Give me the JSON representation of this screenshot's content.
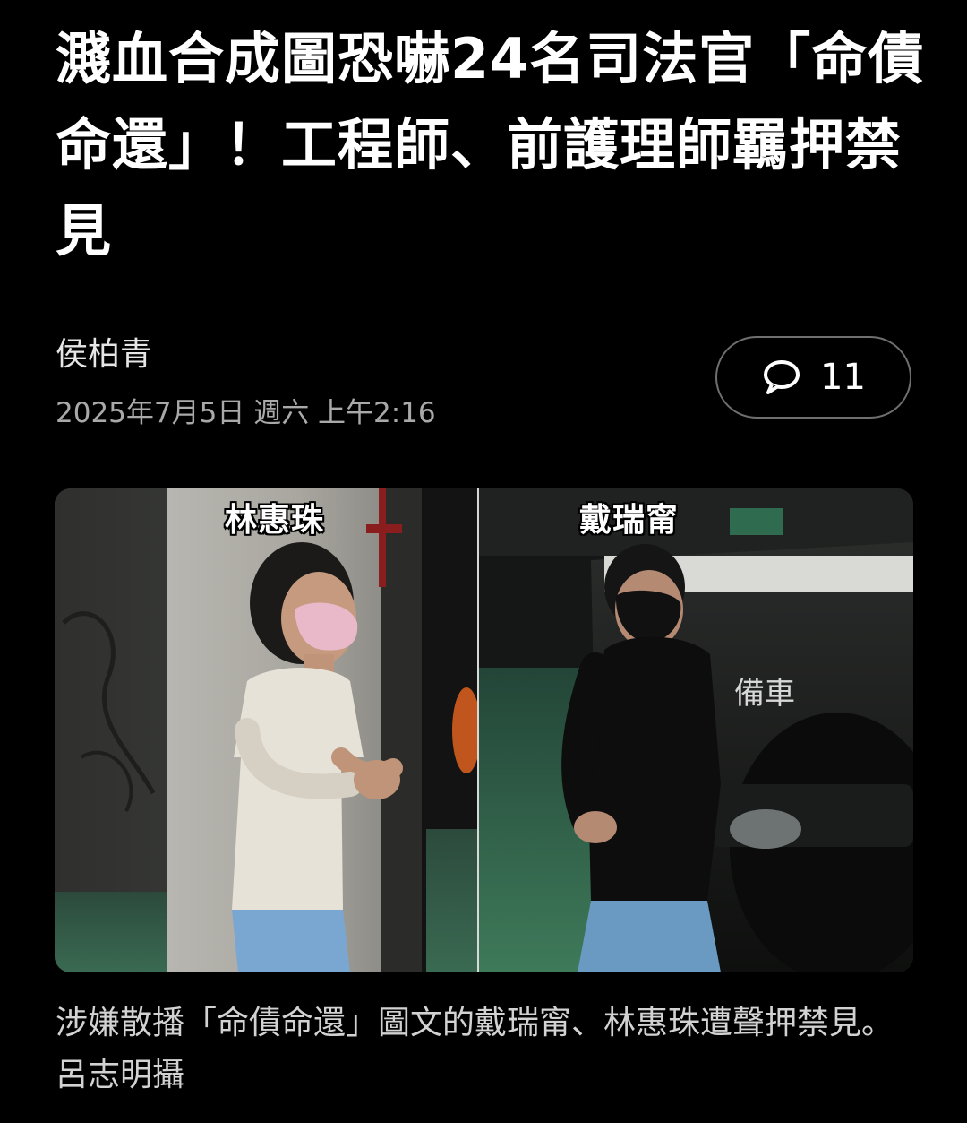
{
  "article": {
    "title": "濺血合成圖恐嚇24名司法官「命債命還」！工程師、前護理師羈押禁見",
    "author": "侯柏青",
    "date": "2025年7月5日 週六 上午2:16",
    "comment_icon": "speech-bubble-icon",
    "comment_count": "11"
  },
  "photo": {
    "left_label": "林惠珠",
    "right_label": "戴瑞甯",
    "vehicle_text": "備車"
  },
  "caption": "涉嫌散播「命債命還」圖文的戴瑞甯、林惠珠遭聲押禁見。呂志明攝",
  "colors": {
    "background": "#000000",
    "text_primary": "#ffffff",
    "text_secondary": "#a9a9a9",
    "button_border": "#6f6f6f"
  }
}
